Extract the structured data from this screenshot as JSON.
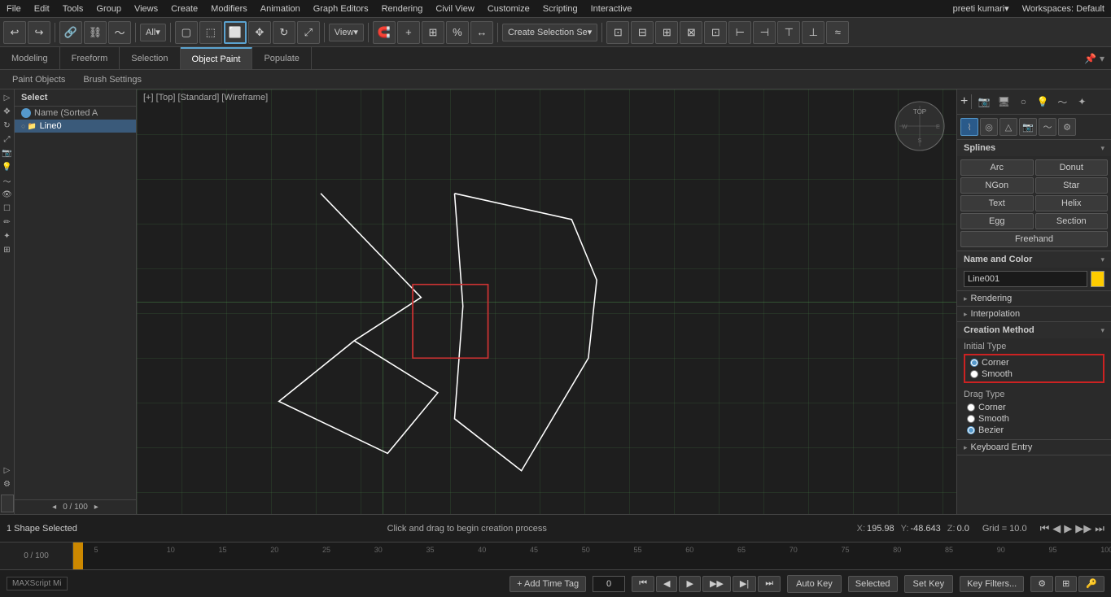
{
  "menuBar": {
    "items": [
      "File",
      "Edit",
      "Tools",
      "Group",
      "Views",
      "Create",
      "Modifiers",
      "Animation",
      "Graph Editors",
      "Rendering",
      "Civil View",
      "Customize",
      "Scripting",
      "Interactive"
    ],
    "user": "preeti kumari",
    "workspace": "Workspaces: Default"
  },
  "toolbar": {
    "createSelectionBtn": "Create Selection Se",
    "viewDropdown": "View",
    "selectionDropdown": "All"
  },
  "tabs": {
    "items": [
      "Modeling",
      "Freeform",
      "Selection",
      "Object Paint",
      "Populate"
    ],
    "active": "Object Paint"
  },
  "subTabs": {
    "items": [
      "Paint Objects",
      "Brush Settings"
    ]
  },
  "scenePanelHeader": "Select",
  "sceneItems": [
    {
      "label": "Name (Sorted A",
      "type": "header"
    },
    {
      "label": "Line0",
      "type": "item",
      "selected": true
    }
  ],
  "viewport": {
    "header": "[+] [Top] [Standard] [Wireframe]"
  },
  "rightPanel": {
    "splines": {
      "title": "Splines",
      "buttons": [
        "Arc",
        "Donut",
        "NGon",
        "Star",
        "Text",
        "Helix",
        "Egg",
        "Section",
        "Freehand"
      ]
    },
    "nameColor": {
      "label": "Name and Color",
      "inputValue": "Line001",
      "color": "#ffcc00"
    },
    "rendering": {
      "label": "Rendering"
    },
    "interpolation": {
      "label": "Interpolation"
    },
    "creationMethod": {
      "label": "Creation Method",
      "initialType": {
        "label": "Initial Type",
        "options": [
          "Corner",
          "Smooth"
        ],
        "selected": "Corner"
      },
      "dragType": {
        "label": "Drag Type",
        "options": [
          "Corner",
          "Smooth",
          "Bezier"
        ],
        "selected": "Bezier"
      }
    },
    "keyboardEntry": {
      "label": "Keyboard Entry"
    }
  },
  "statusBar": {
    "selectedText": "1 Shape Selected",
    "hint": "Click and drag to begin creation process",
    "x": "X: 195.98",
    "y": "Y: -48.643",
    "z": "Z: 0.0",
    "grid": "Grid = 10.0"
  },
  "timeline": {
    "range": "0 / 100",
    "marks": [
      "0",
      "5",
      "10",
      "15",
      "20",
      "25",
      "30",
      "35",
      "40",
      "45",
      "50",
      "55",
      "60",
      "65",
      "70",
      "75",
      "80",
      "85",
      "90",
      "95",
      "100"
    ]
  },
  "bottomBar": {
    "autoKey": "Auto Key",
    "selected": "Selected",
    "setKey": "Set Key",
    "keyFilters": "Key Filters...",
    "frameInput": "0"
  },
  "icons": {
    "undo": "↩",
    "redo": "↪",
    "link": "🔗",
    "unlink": "⛓",
    "plus": "+",
    "minus": "−",
    "move": "✥",
    "rotate": "↻",
    "scale": "⤢",
    "select": "▢",
    "snap": "🧲",
    "chevronDown": "▾",
    "chevronRight": "▸",
    "chevronLeft": "◂",
    "play": "▶",
    "stop": "■",
    "prev": "⏮",
    "next": "⏭"
  }
}
